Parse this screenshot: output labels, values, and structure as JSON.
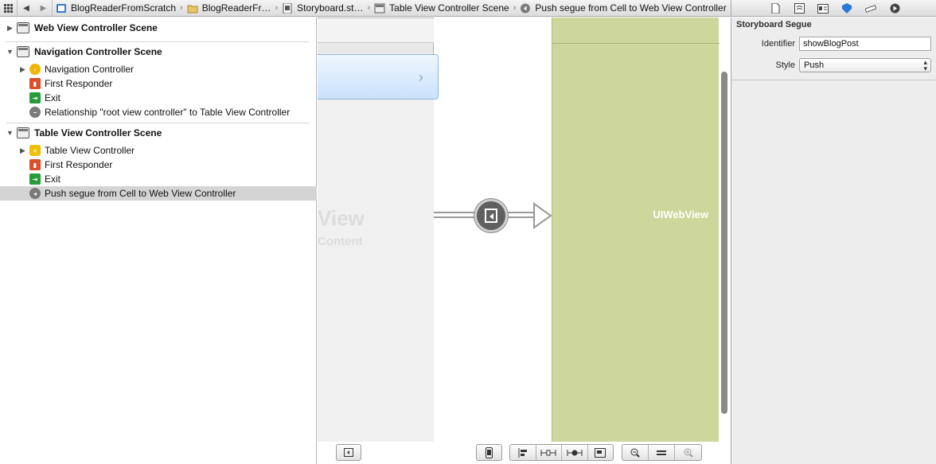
{
  "jumpbar": {
    "crumbs": [
      {
        "label": "BlogReaderFromScratch",
        "icon": "project-icon"
      },
      {
        "label": "BlogReaderFr…",
        "icon": "folder-icon"
      },
      {
        "label": "Storyboard.st…",
        "icon": "storyboard-icon"
      },
      {
        "label": "Table View Controller Scene",
        "icon": "scene-icon"
      },
      {
        "label": "Push segue from Cell to Web View Controller",
        "icon": "segue-icon"
      }
    ]
  },
  "outline": {
    "scenes": [
      {
        "title": "Web View Controller Scene",
        "expanded": false,
        "items": []
      },
      {
        "title": "Navigation Controller Scene",
        "expanded": true,
        "items": [
          {
            "label": "Navigation Controller",
            "icon": "navigation-controller-icon",
            "disclosure": true
          },
          {
            "label": "First Responder",
            "icon": "first-responder-icon",
            "disclosure": false
          },
          {
            "label": "Exit",
            "icon": "exit-icon",
            "disclosure": false
          },
          {
            "label": "Relationship \"root view controller\" to Table View Controller",
            "icon": "relationship-icon",
            "disclosure": false
          }
        ]
      },
      {
        "title": "Table View Controller Scene",
        "expanded": true,
        "items": [
          {
            "label": "Table View Controller",
            "icon": "table-view-controller-icon",
            "disclosure": true
          },
          {
            "label": "First Responder",
            "icon": "first-responder-icon",
            "disclosure": false
          },
          {
            "label": "Exit",
            "icon": "exit-icon",
            "disclosure": false
          },
          {
            "label": "Push segue from Cell to Web View Controller",
            "icon": "segue-icon",
            "disclosure": false,
            "selected": true
          }
        ]
      }
    ]
  },
  "canvas": {
    "ghost_title": "View",
    "ghost_subtitle": "Content",
    "webview_label": "UIWebView"
  },
  "inspector": {
    "section_title": "Storyboard Segue",
    "identifier_label": "Identifier",
    "identifier_value": "showBlogPost",
    "style_label": "Style",
    "style_value": "Push"
  },
  "colors": {
    "webview_bg": "#cdd79b",
    "selection": "#d4d4d4",
    "cell_blue": "#c9e2fb"
  }
}
